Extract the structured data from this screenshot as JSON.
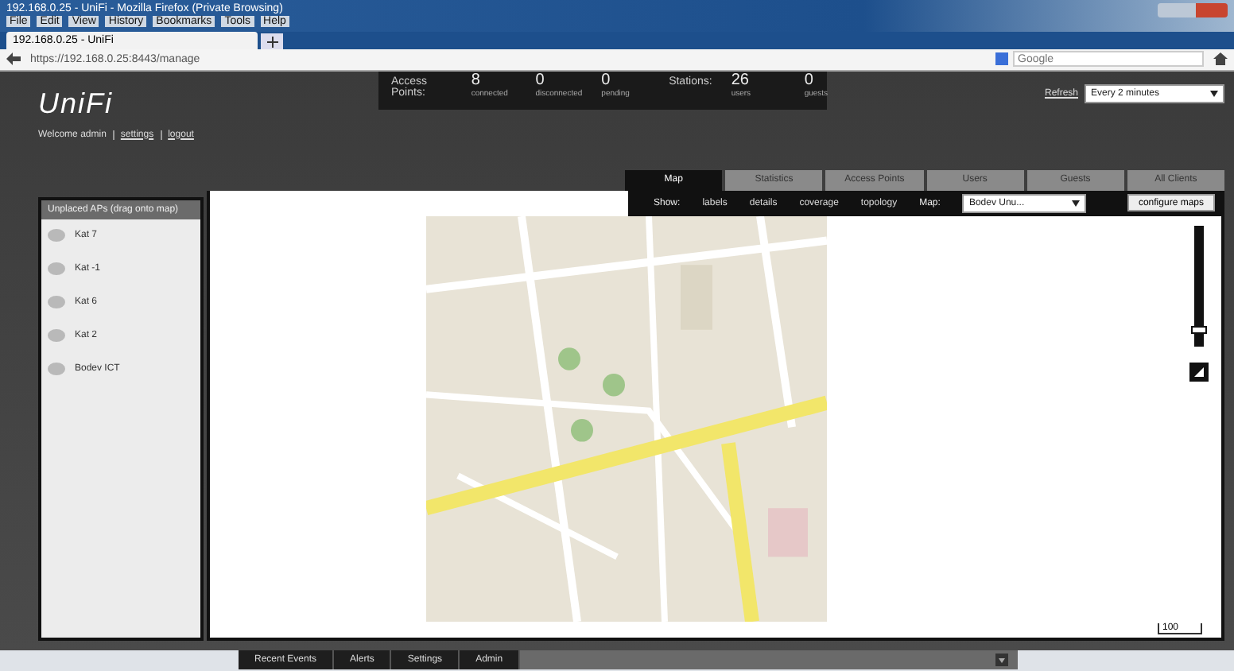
{
  "browser": {
    "title": "192.168.0.25 - UniFi - Mozilla Firefox (Private Browsing)",
    "menu": [
      "File",
      "Edit",
      "View",
      "History",
      "Bookmarks",
      "Tools",
      "Help"
    ],
    "tab": "192.168.0.25 - UniFi",
    "url": "https://192.168.0.25:8443/manage",
    "search": {
      "placeholder": "Google"
    }
  },
  "header": {
    "logo": "UniFi",
    "welcome": "Welcome admin",
    "links": [
      "settings",
      "logout"
    ],
    "stats": [
      {
        "label": "Access Points:",
        "items": [
          {
            "value": "8",
            "caption": "connected"
          },
          {
            "value": "0",
            "caption": "disconnected"
          },
          {
            "value": "0",
            "caption": "pending"
          }
        ]
      },
      {
        "label": "Stations:",
        "items": [
          {
            "value": "26",
            "caption": "users"
          },
          {
            "value": "0",
            "caption": "guests"
          }
        ]
      }
    ],
    "refresh": {
      "label": "Refresh",
      "value": "Every 2 minutes"
    }
  },
  "tabs": [
    {
      "label": "Map",
      "selected": true
    },
    {
      "label": "Statistics",
      "selected": false
    },
    {
      "label": "Access Points",
      "selected": false
    },
    {
      "label": "Users",
      "selected": false
    },
    {
      "label": "Guests",
      "selected": false
    },
    {
      "label": "All Clients",
      "selected": false
    }
  ],
  "toolbar": {
    "show_label": "Show:",
    "options": [
      "labels",
      "details",
      "coverage",
      "topology"
    ],
    "map_label": "Map:",
    "map_value": "Bodev Unu...",
    "configure": "configure maps"
  },
  "unplaced": {
    "title": "Unplaced APs (drag onto map)",
    "items": [
      "Kat 7",
      "Kat -1",
      "Kat 6",
      "Kat 2",
      "Bodev ICT"
    ]
  },
  "map": {
    "scale": "100",
    "zoom": {
      "level": 0.12
    }
  },
  "bottom_tabs": [
    "Recent Events",
    "Alerts",
    "Settings",
    "Admin"
  ]
}
